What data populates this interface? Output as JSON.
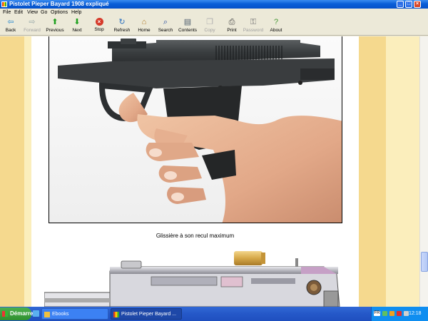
{
  "window": {
    "title": "Pistolet Pieper Bayard 1908 expliqué"
  },
  "menu": [
    "File",
    "Edit",
    "View",
    "Go",
    "Options",
    "Help"
  ],
  "toolbar": [
    {
      "label": "Back",
      "icon": "back-arrow-icon",
      "enabled": true
    },
    {
      "label": "Forward",
      "icon": "forward-arrow-icon",
      "enabled": false
    },
    {
      "label": "Previous",
      "icon": "up-arrow-icon",
      "enabled": true
    },
    {
      "label": "Next",
      "icon": "down-arrow-icon",
      "enabled": true
    },
    {
      "label": "Stop",
      "icon": "stop-icon",
      "enabled": true
    },
    {
      "label": "Refresh",
      "icon": "refresh-icon",
      "enabled": true
    },
    {
      "label": "Home",
      "icon": "home-icon",
      "enabled": true
    },
    {
      "label": "Search",
      "icon": "search-icon",
      "enabled": true
    },
    {
      "label": "Contents",
      "icon": "contents-icon",
      "enabled": true
    },
    {
      "label": "Copy",
      "icon": "copy-icon",
      "enabled": false
    },
    {
      "label": "Print",
      "icon": "print-icon",
      "enabled": true
    },
    {
      "label": "Password",
      "icon": "key-icon",
      "enabled": false
    },
    {
      "label": "About",
      "icon": "about-icon",
      "enabled": true
    }
  ],
  "content": {
    "caption": "Glissière à son recul maximum"
  },
  "taskbar": {
    "start": "Démarrer",
    "tasks": [
      {
        "label": "Ebooks",
        "active": false
      },
      {
        "label": "Pistolet Pieper Bayard ...",
        "active": true
      }
    ],
    "tray_language": "FR",
    "clock": "12:18"
  },
  "colors": {
    "stripe_dark": "#f5d98e",
    "stripe_light": "#fbeebc",
    "titlebar": "#0a5fd8",
    "taskbar": "#2558c8"
  }
}
